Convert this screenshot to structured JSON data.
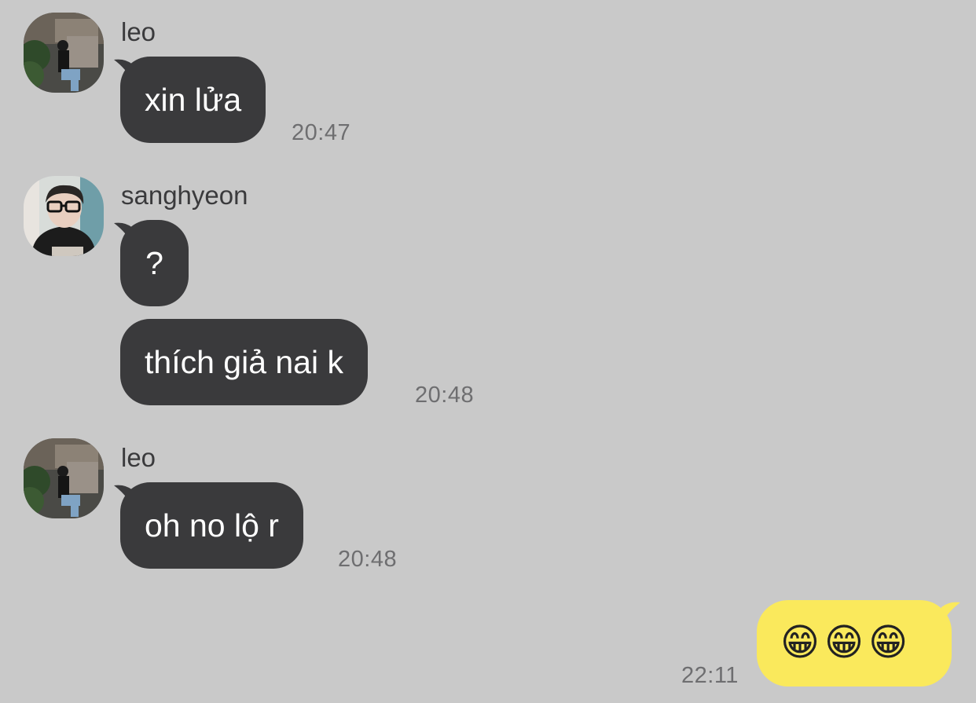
{
  "conversation": {
    "messages": [
      {
        "sender": "leo",
        "avatar_icon": "profile-photo-leo",
        "bubbles": [
          "xin lửa"
        ],
        "time": "20:47"
      },
      {
        "sender": "sanghyeon",
        "avatar_icon": "profile-photo-sanghyeon",
        "bubbles": [
          "?",
          "thích giả nai k"
        ],
        "time": "20:48"
      },
      {
        "sender": "leo",
        "avatar_icon": "profile-photo-leo",
        "bubbles": [
          "oh no lộ r"
        ],
        "time": "20:48"
      }
    ],
    "outgoing": {
      "text": "😁😁😁",
      "time": "22:11"
    }
  },
  "colors": {
    "background": "#c9c9c9",
    "incoming_bubble": "#3a3a3c",
    "outgoing_bubble": "#fae95c",
    "timestamp": "#6e6e70"
  }
}
